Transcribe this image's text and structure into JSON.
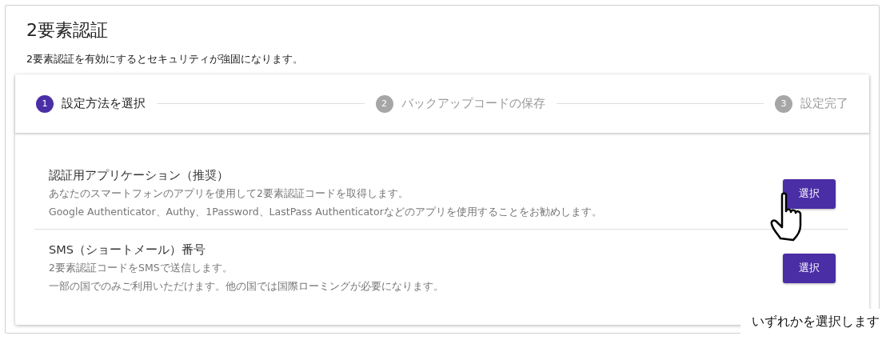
{
  "page": {
    "title": "2要素認証",
    "subtitle": "2要素認証を有効にするとセキュリティが強固になります。"
  },
  "steps": [
    {
      "number": "1",
      "label": "設定方法を選択",
      "selected": true
    },
    {
      "number": "2",
      "label": "バックアップコードの保存",
      "selected": false
    },
    {
      "number": "3",
      "label": "設定完了",
      "selected": false
    }
  ],
  "options": [
    {
      "title": "認証用アプリケーション（推奨）",
      "lines": [
        "あなたのスマートフォンのアプリを使用して2要素認証コードを取得します。",
        "Google Authenticator、Authy、1Password、LastPass Authenticatorなどのアプリを使用することをお勧めします。"
      ],
      "button": "選択"
    },
    {
      "title": "SMS（ショートメール）番号",
      "lines": [
        "2要素認証コードをSMSで送信します。",
        "一部の国でのみご利用いただけます。他の国では国際ローミングが必要になります。"
      ],
      "button": "選択"
    }
  ],
  "annotation": "いずれかを選択します"
}
